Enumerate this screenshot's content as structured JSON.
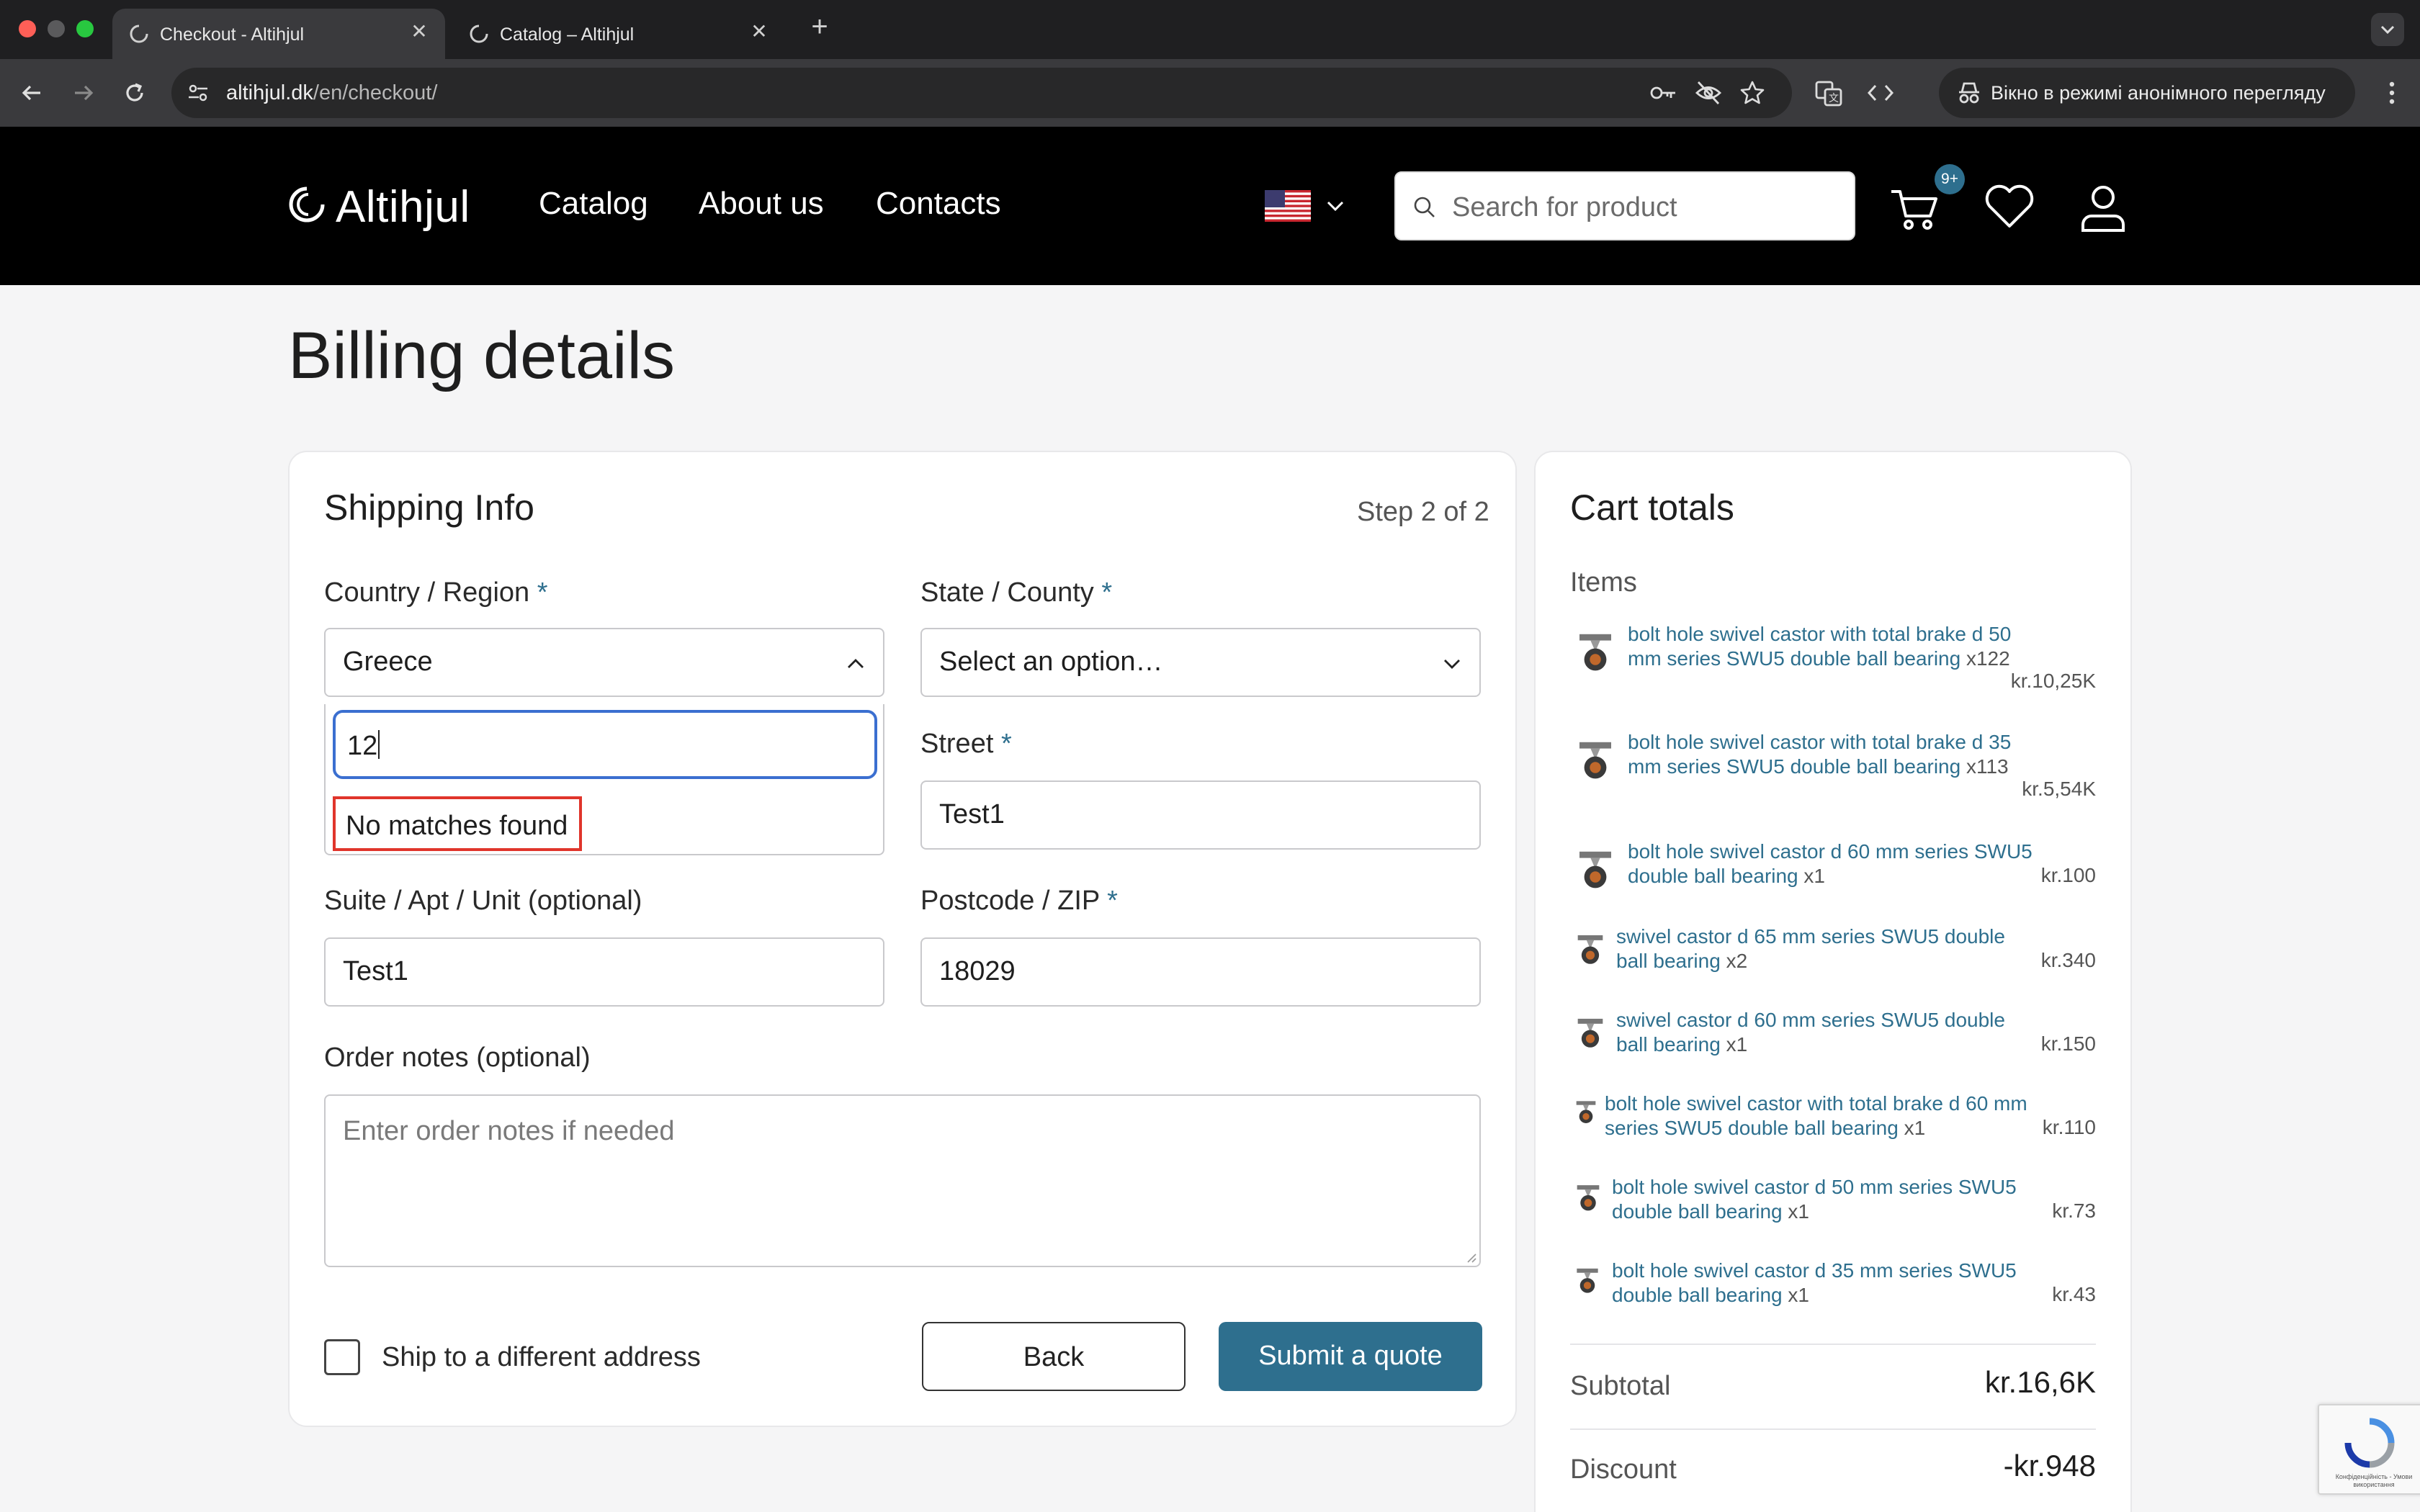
{
  "browser": {
    "tabs": [
      {
        "title": "Checkout - Altihjul",
        "active": true
      },
      {
        "title": "Catalog – Altihjul",
        "active": false
      }
    ],
    "url_host": "altihjul.dk",
    "url_path": "/en/checkout/",
    "incognito_label": "Вікно в режимі анонімного перегляду"
  },
  "header": {
    "logo_text": "Altihjul",
    "nav": [
      "Catalog",
      "About us",
      "Contacts"
    ],
    "search_placeholder": "Search for product",
    "cart_badge": "9+"
  },
  "page": {
    "title": "Billing details"
  },
  "shipping": {
    "title": "Shipping Info",
    "step": "Step 2 of 2",
    "country_label": "Country / Region",
    "country_value": "Greece",
    "state_label": "State / County",
    "state_placeholder": "Select an option…",
    "dropdown_search_value": "12",
    "dropdown_no_results": "No matches found",
    "street_label": "Street",
    "street_value": "Test1",
    "suite_label": "Suite / Apt / Unit (optional)",
    "suite_value": "Test1",
    "postcode_label": "Postcode / ZIP",
    "postcode_value": "18029",
    "notes_label": "Order notes (optional)",
    "notes_placeholder": "Enter order notes if needed",
    "ship_different_label": "Ship to a different address",
    "ship_different_checked": false,
    "back_label": "Back",
    "submit_label": "Submit a quote",
    "required_mark": "*"
  },
  "cart": {
    "title": "Cart totals",
    "items_label": "Items",
    "items": [
      {
        "name": "bolt hole swivel castor with total brake d 50 mm series SWU5 double ball bearing",
        "qty": "x122",
        "price": "kr.10,25K"
      },
      {
        "name": "bolt hole swivel castor with total brake d 35 mm series SWU5 double ball bearing",
        "qty": "x113",
        "price": "kr.5,54K"
      },
      {
        "name": "bolt hole swivel castor d 60 mm series SWU5 double ball bearing",
        "qty": "x1",
        "price": "kr.100"
      },
      {
        "name": "swivel castor d 65 mm series SWU5 double ball bearing",
        "qty": "x2",
        "price": "kr.340"
      },
      {
        "name": "swivel castor d 60 mm series SWU5 double ball bearing",
        "qty": "x1",
        "price": "kr.150"
      },
      {
        "name": "bolt hole swivel castor with total brake d 60 mm series SWU5 double ball bearing",
        "qty": "x1",
        "price": "kr.110"
      },
      {
        "name": "bolt hole swivel castor d 50 mm series SWU5 double ball bearing",
        "qty": "x1",
        "price": "kr.73"
      },
      {
        "name": "bolt hole swivel castor d 35 mm series SWU5 double ball bearing",
        "qty": "x1",
        "price": "kr.43"
      }
    ],
    "subtotal_label": "Subtotal",
    "subtotal_value": "kr.16,6K",
    "discount_label": "Discount",
    "discount_value": "-kr.948"
  },
  "recaptcha_text": "Конфіденційність - Умови використання",
  "colors": {
    "accent": "#2e6f8e",
    "header_bg": "#000000",
    "highlight_border": "#e0352b",
    "focus_border": "#3b6fd0"
  }
}
